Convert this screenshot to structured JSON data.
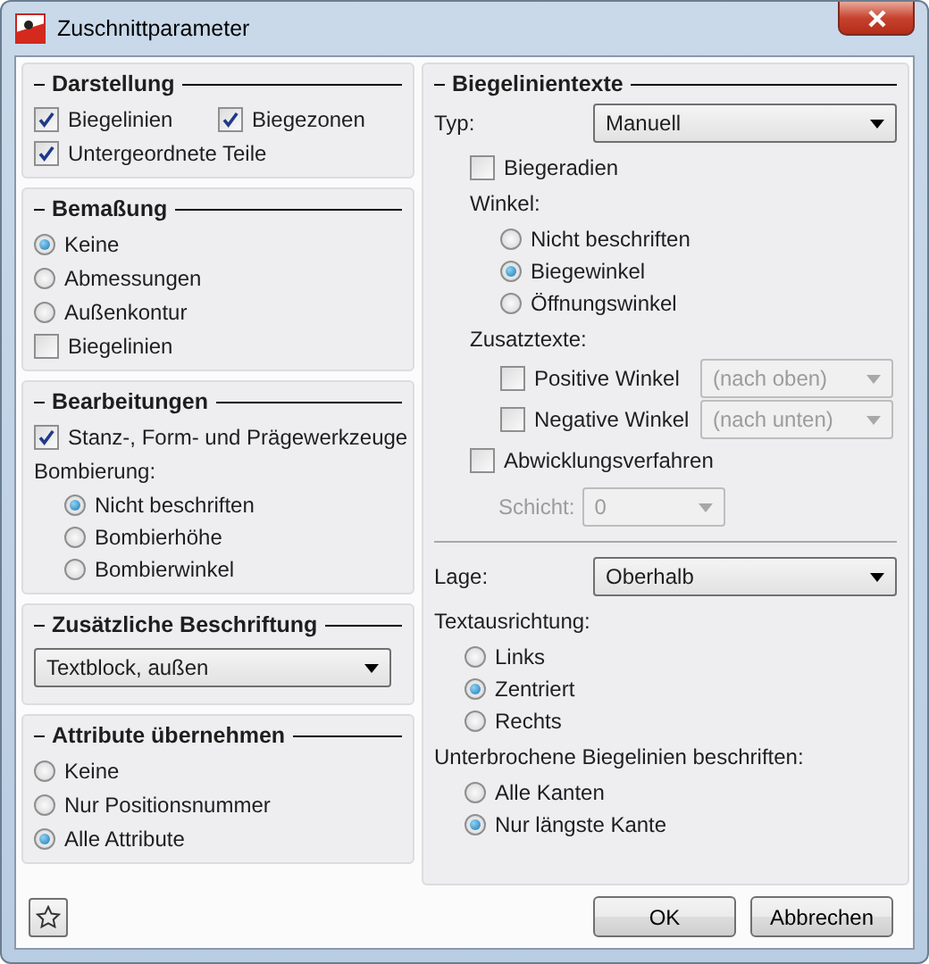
{
  "window": {
    "title": "Zuschnittparameter"
  },
  "left_groups": [
    {
      "title": "Darstellung",
      "items": [
        {
          "kind": "row",
          "children": [
            {
              "kind": "checkbox",
              "label": "Biegelinien",
              "checked": true
            },
            {
              "kind": "checkbox",
              "label": "Biegezonen",
              "checked": true
            }
          ]
        },
        {
          "kind": "checkbox",
          "label": "Untergeordnete Teile",
          "checked": true
        }
      ]
    },
    {
      "title": "Bemaßung",
      "items": [
        {
          "kind": "radio",
          "label": "Keine",
          "selected": true
        },
        {
          "kind": "radio",
          "label": "Abmessungen",
          "selected": false
        },
        {
          "kind": "radio",
          "label": "Außenkontur",
          "selected": false
        },
        {
          "kind": "checkbox",
          "label": "Biegelinien",
          "checked": false
        }
      ]
    },
    {
      "title": "Bearbeitungen",
      "items": [
        {
          "kind": "checkbox",
          "label": "Stanz-, Form- und Prägewerkzeuge",
          "checked": true
        },
        {
          "kind": "label",
          "label": "Bombierung:",
          "children": [
            {
              "kind": "radio",
              "label": "Nicht beschriften",
              "selected": true
            },
            {
              "kind": "radio",
              "label": "Bombierhöhe",
              "selected": false
            },
            {
              "kind": "radio",
              "label": "Bombierwinkel",
              "selected": false
            }
          ]
        }
      ]
    },
    {
      "title": "Zusätzliche Beschriftung",
      "items": [
        {
          "kind": "select",
          "value": "Textblock, außen",
          "disabled": false
        }
      ]
    },
    {
      "title": "Attribute übernehmen",
      "items": [
        {
          "kind": "radio",
          "label": "Keine",
          "selected": false
        },
        {
          "kind": "radio",
          "label": "Nur Positionsnummer",
          "selected": false
        },
        {
          "kind": "radio",
          "label": "Alle Attribute",
          "selected": true
        }
      ]
    }
  ],
  "right_group": {
    "title": "Biegelinientexte",
    "sections": [
      {
        "items": [
          {
            "kind": "field",
            "label": "Typ:",
            "value": "Manuell",
            "disabled": false
          },
          {
            "kind": "block",
            "children": [
              {
                "kind": "checkbox",
                "label": "Biegeradien",
                "checked": false
              },
              {
                "kind": "label",
                "label": "Winkel:",
                "children": [
                  {
                    "kind": "radio",
                    "label": "Nicht beschriften",
                    "selected": false
                  },
                  {
                    "kind": "radio",
                    "label": "Biegewinkel",
                    "selected": true
                  },
                  {
                    "kind": "radio",
                    "label": "Öffnungswinkel",
                    "selected": false
                  }
                ]
              },
              {
                "kind": "label",
                "label": "Zusatztexte:",
                "children": [
                  {
                    "kind": "checkbox-select",
                    "label": "Positive Winkel",
                    "checked": false,
                    "value": "(nach oben)",
                    "disabled": true
                  },
                  {
                    "kind": "checkbox-select",
                    "label": "Negative Winkel",
                    "checked": false,
                    "value": "(nach unten)",
                    "disabled": true
                  }
                ]
              },
              {
                "kind": "checkbox",
                "label": "Abwicklungsverfahren",
                "checked": false,
                "children": [
                  {
                    "kind": "select",
                    "label": "Schicht:",
                    "value": "0",
                    "disabled": true
                  }
                ]
              }
            ]
          }
        ]
      },
      {
        "items": [
          {
            "kind": "field",
            "label": "Lage:",
            "value": "Oberhalb",
            "disabled": false
          },
          {
            "kind": "label",
            "label": "Textausrichtung:",
            "children": [
              {
                "kind": "radio",
                "label": "Links",
                "selected": false
              },
              {
                "kind": "radio",
                "label": "Zentriert",
                "selected": true
              },
              {
                "kind": "radio",
                "label": "Rechts",
                "selected": false
              }
            ]
          },
          {
            "kind": "label",
            "label": "Unterbrochene Biegelinien beschriften:",
            "children": [
              {
                "kind": "radio",
                "label": "Alle Kanten",
                "selected": false
              },
              {
                "kind": "radio",
                "label": "Nur längste Kante",
                "selected": true
              }
            ]
          }
        ]
      }
    ]
  },
  "buttons": [
    "OK",
    "Abbrechen"
  ]
}
